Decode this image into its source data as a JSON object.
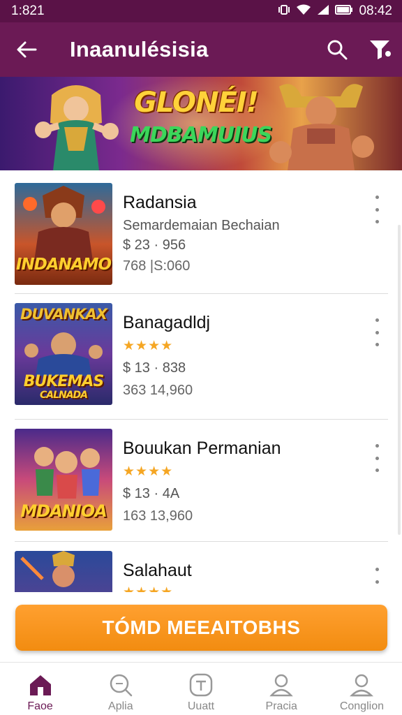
{
  "status_bar": {
    "time": "1:821",
    "battery_time": "08:42",
    "icons": [
      "vibrate-icon",
      "wifi-icon",
      "signal-icon",
      "battery-icon"
    ]
  },
  "app_bar": {
    "title": "Inaanulésisia",
    "back_icon": "arrow-left-icon",
    "search_icon": "search-icon",
    "filter_icon": "filter-icon"
  },
  "banner": {
    "title": "GLONÉI!",
    "subtitle": "MDBAMUIUS"
  },
  "games": [
    {
      "name": "Radansia",
      "subtitle": "Semardemaian Bechaian",
      "price": "$ 23 · 956",
      "count": "768 |S:060",
      "thumb_label": "INDANAMO"
    },
    {
      "name": "Banagadldj",
      "rating": "★★★★",
      "price": "$ 13 · 838",
      "count": "363 14,960",
      "thumb_label": "BUKEMAS",
      "thumb_label_top": "DUVANKAX",
      "thumb_label_bottom": "CALNADA"
    },
    {
      "name": "Bouukan Permanian",
      "rating": "★★★★",
      "price": "$ 13 · 4A",
      "count": "163 13,960",
      "thumb_label": "MDANIOA"
    },
    {
      "name": "Salahaut",
      "rating": "★★★★"
    }
  ],
  "cta": {
    "label": "TÓMD MEEAITOBHS"
  },
  "bottom_nav": [
    {
      "label": "Faoe",
      "icon": "home-icon",
      "active": true
    },
    {
      "label": "Aplia",
      "icon": "search-icon",
      "active": false
    },
    {
      "label": "Uuatt",
      "icon": "add-icon",
      "active": false
    },
    {
      "label": "Pracia",
      "icon": "user-icon",
      "active": false
    },
    {
      "label": "Conglion",
      "icon": "profile-icon",
      "active": false
    }
  ],
  "colors": {
    "primary": "#6b1a55",
    "status_bar": "#5a1247",
    "accent": "#f5941b",
    "star": "#f5a623"
  }
}
